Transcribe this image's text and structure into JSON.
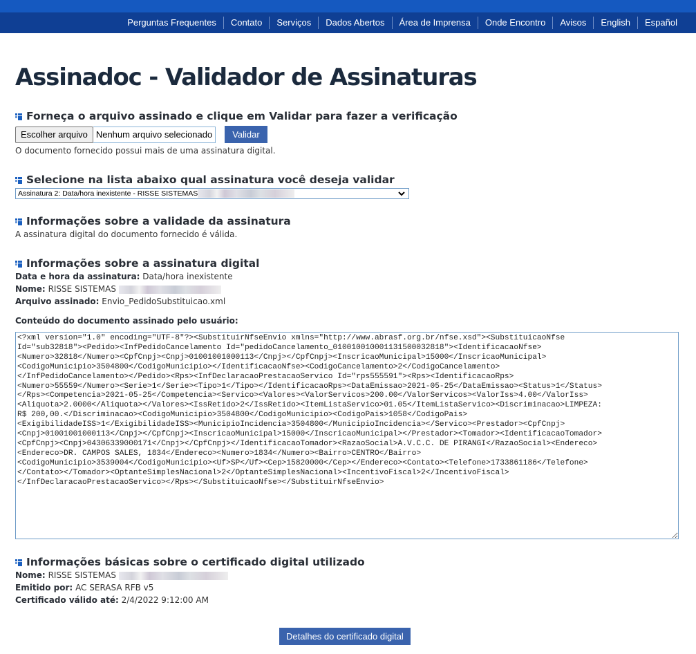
{
  "nav": {
    "links": [
      "Perguntas Frequentes",
      "Contato",
      "Serviços",
      "Dados Abertos",
      "Área de Imprensa",
      "Onde Encontro",
      "Avisos",
      "English",
      "Español"
    ]
  },
  "page": {
    "title": "Assinadoc - Validador de Assinaturas"
  },
  "upload": {
    "heading": "Forneça o arquivo assinado e clique em Validar para fazer a verificação",
    "choose_label": "Escolher arquivo",
    "file_status": "Nenhum arquivo selecionado",
    "validate_label": "Validar",
    "message": "O documento fornecido possui mais de uma assinatura digital."
  },
  "select_signature": {
    "heading": "Selecione na lista abaixo qual assinatura você deseja validar",
    "selected": "Assinatura 2: Data/hora inexistente - RISSE SISTEMAS"
  },
  "validity": {
    "heading": "Informações sobre a validade da assinatura",
    "message": "A assinatura digital do documento fornecido é válida."
  },
  "signature_info": {
    "heading": "Informações sobre a assinatura digital",
    "datetime_label": "Data e hora da assinatura:",
    "datetime_value": "Data/hora inexistente",
    "name_label": "Nome:",
    "name_value": "RISSE SISTEMAS",
    "file_label": "Arquivo assinado:",
    "file_value": "Envio_PedidoSubstituicao.xml",
    "content_label": "Conteúdo do documento assinado pelo usuário:",
    "content": "<?xml version=\"1.0\" encoding=\"UTF-8\"?><SubstituirNfseEnvio xmlns=\"http://www.abrasf.org.br/nfse.xsd\"><SubstituicaoNfse\nId=\"sub32818\"><Pedido><InfPedidoCancelamento Id=\"pedidoCancelamento_01001001000113150003281 8\"><IdentificacaoNfse>\n<Numero>32818</Numero><CpfCnpj><Cnpj>01001001000113</Cnpj></CpfCnpj><InscricaoMunicipal>15000</InscricaoMunicipal>\n<CodigoMunicipio>3504800</CodigoMunicipio></IdentificacaoNfse><CodigoCancelamento>2</CodigoCancelamento>\n</InfPedidoCancelamento></Pedido><Rps><InfDeclaracaoPrestacaoServico Id=\"rps555591\"><Rps><IdentificacaoRps>\n<Numero>55559</Numero><Serie>1</Serie><Tipo>1</Tipo></IdentificacaoRps><DataEmissao>2021-05-25</DataEmissao><Status>1</Status>\n</Rps><Competencia>2021-05-25</Competencia><Servico><Valores><ValorServicos>200.00</ValorServicos><ValorIss>4.00</ValorIss>\n<Aliquota>2.0000</Aliquota></Valores><IssRetido>2</IssRetido><ItemListaServico>01.05</ItemListaServico><Discriminacao>LIMPEZA:\nR$ 200,00.</Discriminacao><CodigoMunicipio>3504800</CodigoMunicipio><CodigoPais>1058</CodigoPais>\n<ExigibilidadeISS>1</ExigibilidadeISS><MunicipioIncidencia>3504800</MunicipioIncidencia></Servico><Prestador><CpfCnpj>\n<Cnpj>01001001000113</Cnpj></CpfCnpj><InscricaoMunicipal>15000</InscricaoMunicipal></Prestador><Tomador><IdentificacaoTomador>\n<CpfCnpj><Cnpj>04306339000171</Cnpj></CpfCnpj></IdentificacaoTomador><RazaoSocial>A.V.C.C. DE PIRANGI</RazaoSocial><Endereco>\n<Endereco>DR. CAMPOS SALES, 1834</Endereco><Numero>1834</Numero><Bairro>CENTRO</Bairro>\n<CodigoMunicipio>3539004</CodigoMunicipio><Uf>SP</Uf><Cep>15820000</Cep></Endereco><Contato><Telefone>1733861186</Telefone>\n</Contato></Tomador><OptanteSimplesNacional>2</OptanteSimplesNacional><IncentivoFiscal>2</IncentivoFiscal>\n</InfDeclaracaoPrestacaoServico></Rps></SubstituicaoNfse></SubstituirNfseEnvio>"
  },
  "certificate": {
    "heading": "Informações básicas sobre o certificado digital utilizado",
    "name_label": "Nome:",
    "name_value": "RISSE SISTEMAS",
    "issuer_label": "Emitido por:",
    "issuer_value": "AC SERASA RFB v5",
    "valid_label": "Certificado válido até:",
    "valid_value": "2/4/2022 9:12:00 AM",
    "details_label": "Detalhes do certificado digital"
  }
}
